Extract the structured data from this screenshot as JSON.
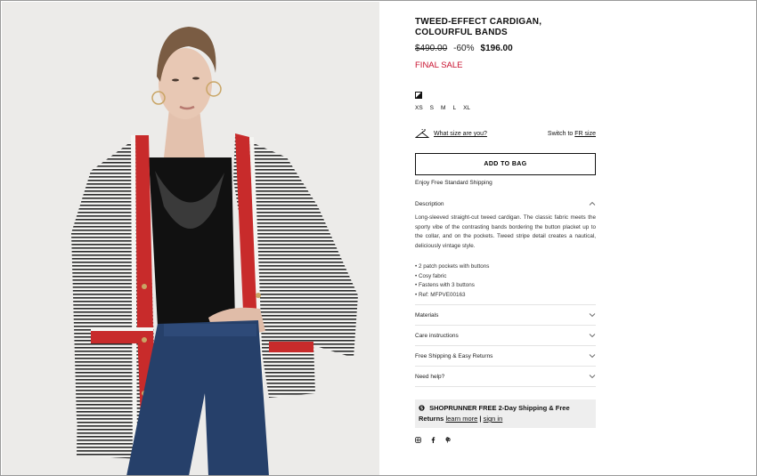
{
  "product": {
    "title": "TWEED-EFFECT CARDIGAN, COLOURFUL BANDS",
    "original_price": "$490.00",
    "discount": "-60%",
    "sale_price": "$196.00",
    "sale_label": "FINAL SALE",
    "sizes": [
      "XS",
      "S",
      "M",
      "L",
      "XL"
    ]
  },
  "size_guide": {
    "link": "What size are you?",
    "switch_prefix": "Switch to",
    "switch_link": "FR size"
  },
  "cart": {
    "add_label": "ADD TO BAG",
    "shipping_note": "Enjoy Free Standard Shipping"
  },
  "description": {
    "heading": "Description",
    "text": "Long-sleeved straight-cut tweed cardigan. The classic fabric meets the sporty vibe of the contrasting bands bordering the button placket up to the collar, and on the pockets. Tweed stripe detail creates a nautical, deliciously vintage style.",
    "bullets": [
      "• 2 patch pockets with buttons",
      "• Cosy fabric",
      "• Fastens with 3 buttons",
      "• Ref: MFPVE00163"
    ]
  },
  "accordions": [
    "Materials",
    "Care instructions",
    "Free Shipping & Easy Returns",
    "Need help?"
  ],
  "shoprunner": {
    "brand": "SHOPRUNNER",
    "offer": "FREE 2-Day Shipping & Free Returns",
    "learn_more": "learn more",
    "separator": "|",
    "sign_in": "sign in"
  },
  "social_icons": [
    "instagram-icon",
    "facebook-icon",
    "pinterest-icon"
  ],
  "colors": {
    "sale_red": "#c8102e",
    "background_photo": "#ecebe9"
  }
}
